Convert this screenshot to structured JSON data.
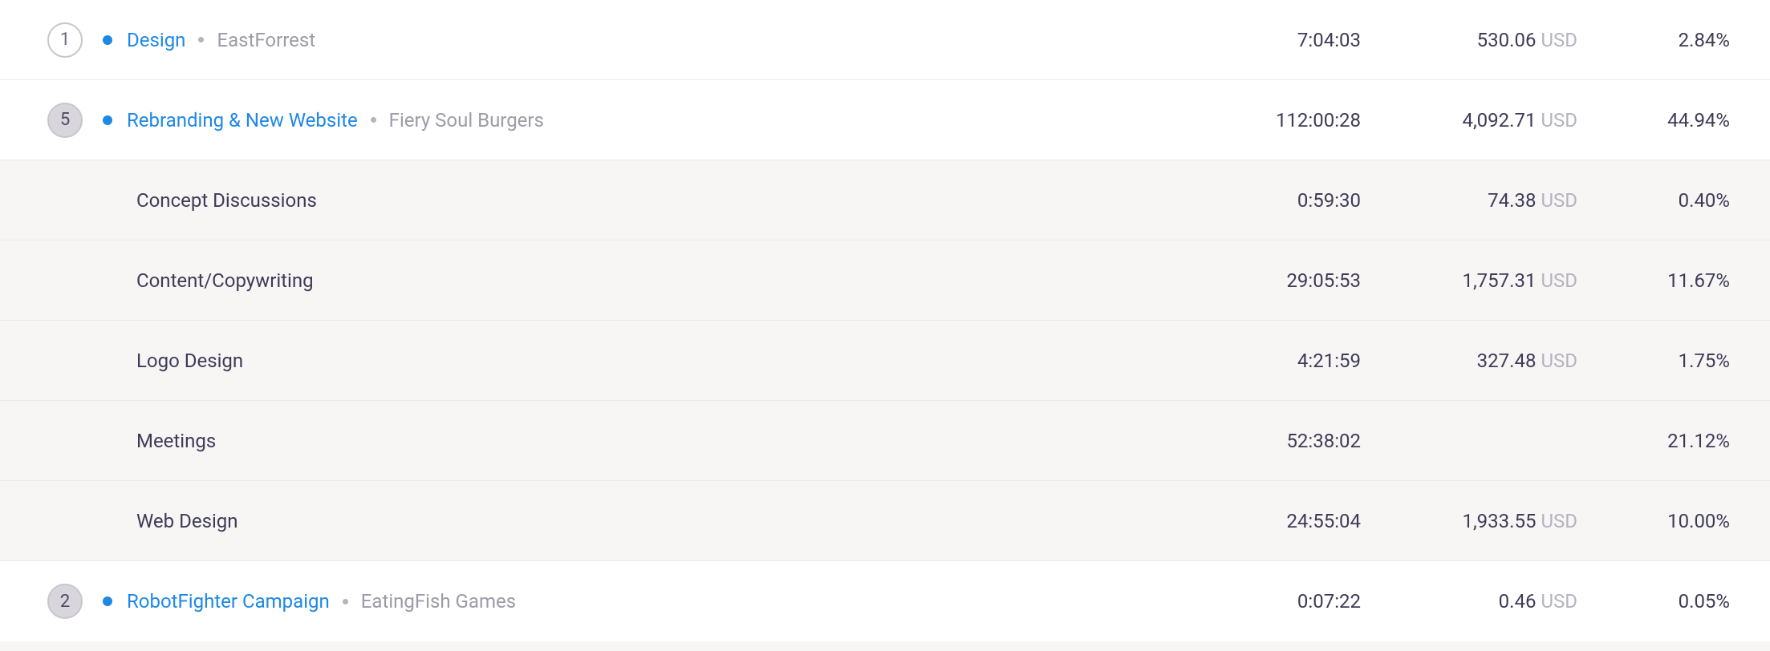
{
  "currency": "USD",
  "rows": [
    {
      "type": "project",
      "count": "1",
      "highlight": false,
      "project": "Design",
      "client": "EastForrest",
      "time": "7:04:03",
      "amount": "530.06",
      "percent": "2.84%"
    },
    {
      "type": "project",
      "count": "5",
      "highlight": true,
      "project": "Rebranding & New Website",
      "client": "Fiery Soul Burgers",
      "time": "112:00:28",
      "amount": "4,092.71",
      "percent": "44.94%"
    },
    {
      "type": "task",
      "task": "Concept Discussions",
      "time": "0:59:30",
      "amount": "74.38",
      "percent": "0.40%"
    },
    {
      "type": "task",
      "task": "Content/Copywriting",
      "time": "29:05:53",
      "amount": "1,757.31",
      "percent": "11.67%"
    },
    {
      "type": "task",
      "task": "Logo Design",
      "time": "4:21:59",
      "amount": "327.48",
      "percent": "1.75%"
    },
    {
      "type": "task",
      "task": "Meetings",
      "time": "52:38:02",
      "amount": "",
      "percent": "21.12%"
    },
    {
      "type": "task",
      "task": "Web Design",
      "time": "24:55:04",
      "amount": "1,933.55",
      "percent": "10.00%"
    },
    {
      "type": "project",
      "count": "2",
      "highlight": true,
      "project": "RobotFighter Campaign",
      "client": "EatingFish Games",
      "time": "0:07:22",
      "amount": "0.46",
      "percent": "0.05%",
      "last": true
    }
  ]
}
